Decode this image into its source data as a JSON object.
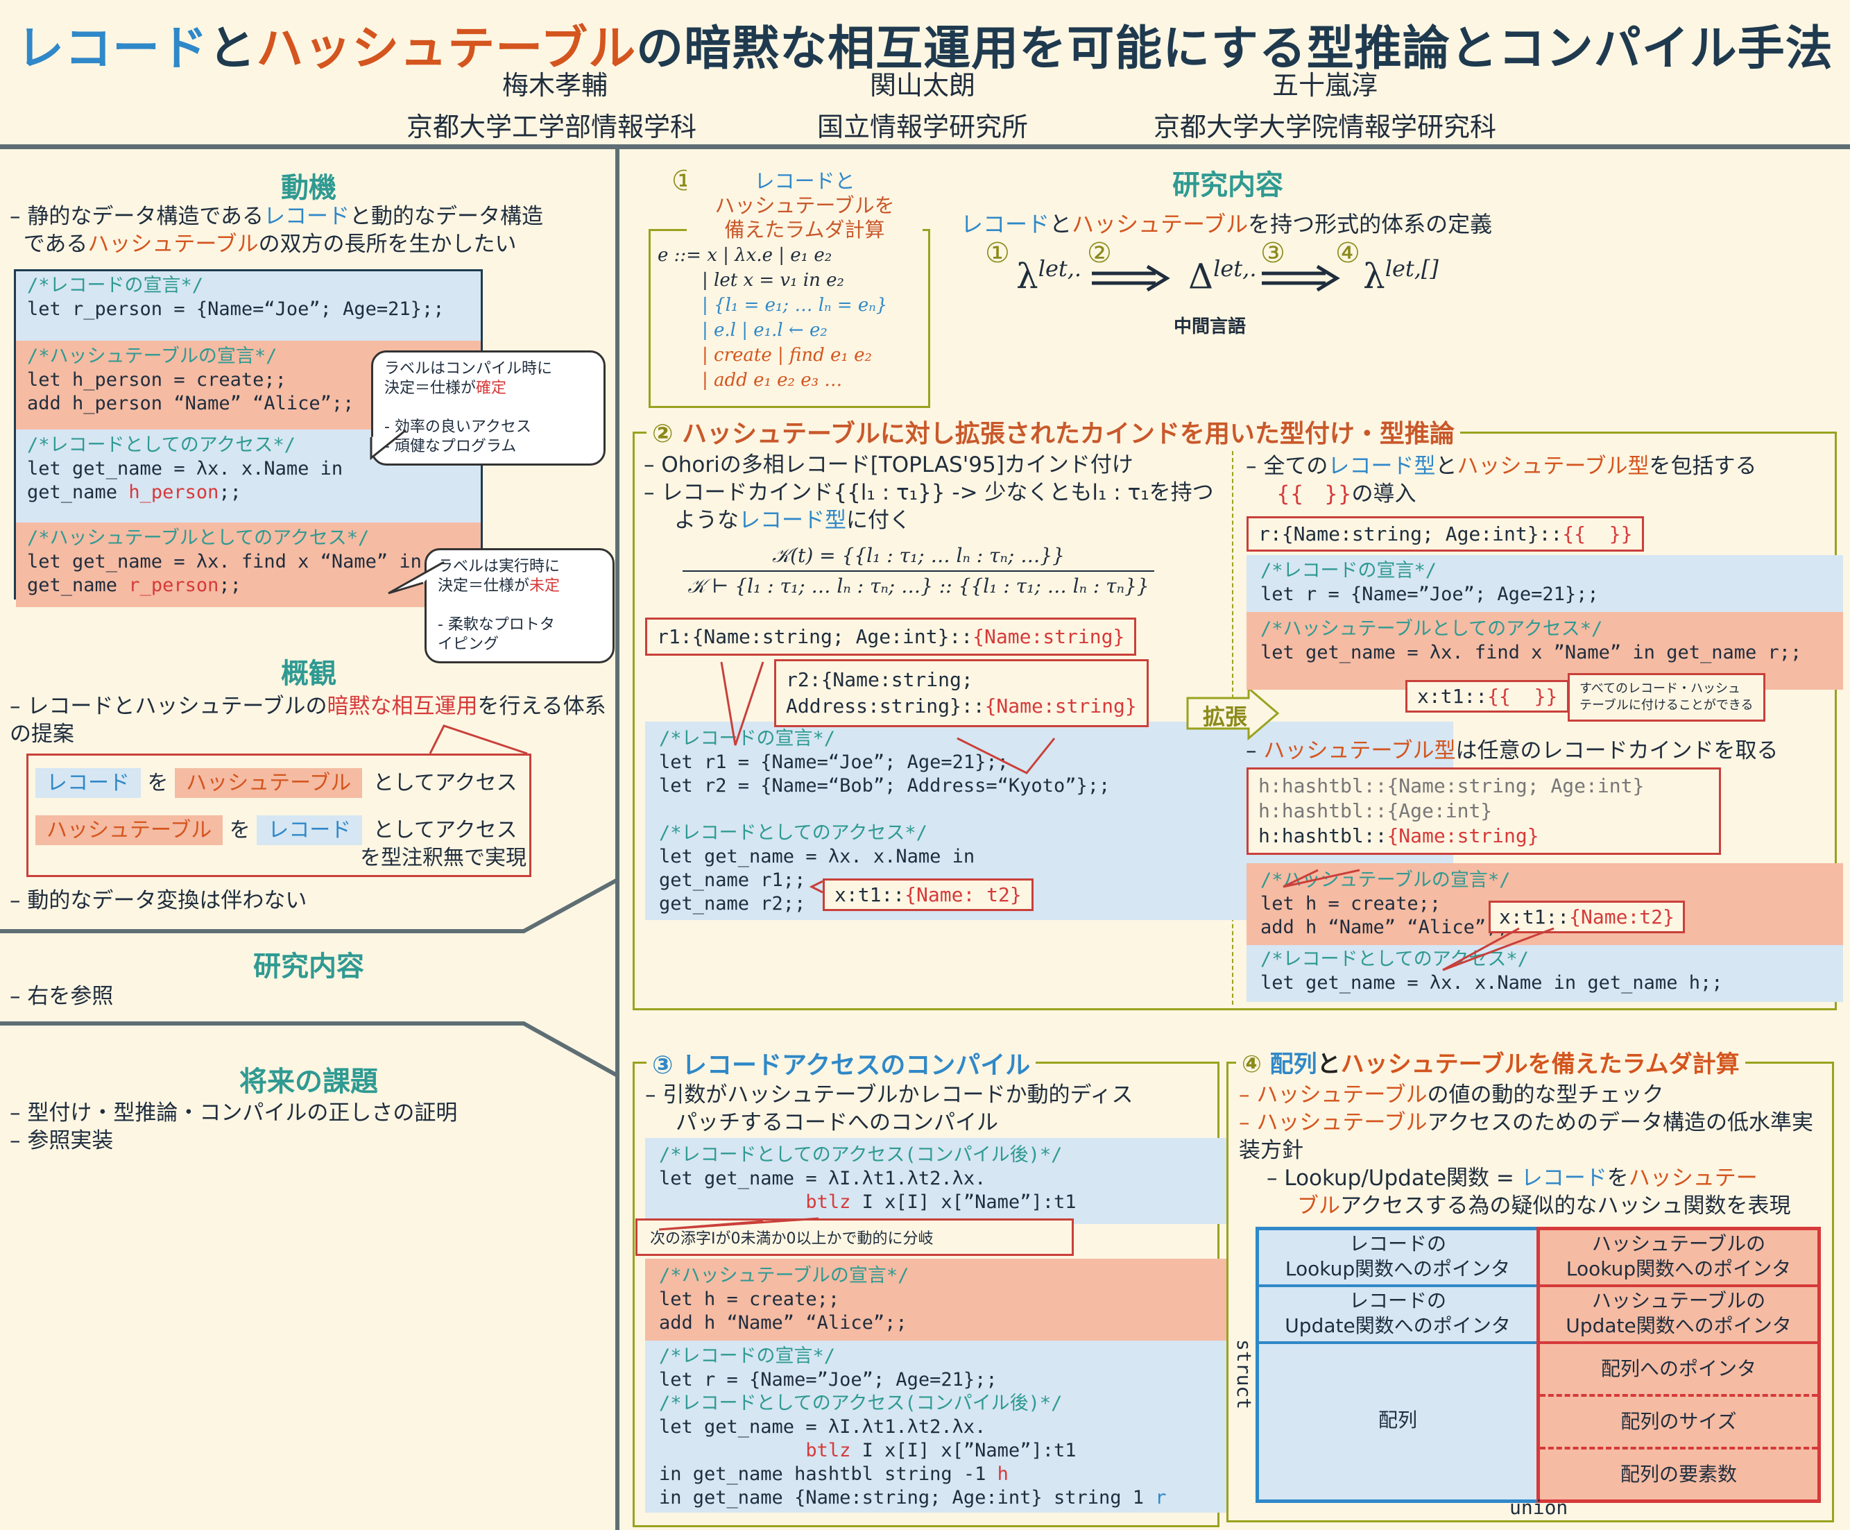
{
  "header": {
    "title_parts": [
      "レコード",
      "と",
      "ハッシュテーブル",
      "の暗黙な相互運用を可能にする型推論とコンパイル手法"
    ],
    "authors": [
      {
        "name": "梅木孝輔",
        "affiliation": "京都大学工学部情報学科"
      },
      {
        "name": "関山太朗",
        "affiliation": "国立情報学研究所"
      },
      {
        "name": "五十嵐淳",
        "affiliation": "京都大学大学院情報学研究科"
      }
    ]
  },
  "motivation": {
    "title": "動機",
    "bullet_parts": [
      "静的なデータ構造である",
      "レコード",
      "と動的なデータ構造であ",
      "ハッシュテーブル",
      "の双方の長所を生かしたい"
    ],
    "bullet_line2_prefix": "である",
    "code1_comment": "/*レコードの宣言*/",
    "code1_line": "let r_person = {Name=“Joe”; Age=21};;",
    "code2_comment": "/*ハッシュテーブルの宣言*/",
    "code2_line1": "let h_person = create;;",
    "code2_line2": "add h_person “Name” “Alice”;;",
    "code3_comment": "/*レコードとしてのアクセス*/",
    "code3_line1": "let get_name = λx. x.Name in",
    "code3_line2_a": "get_name ",
    "code3_line2_b": "h_person",
    ";;": ";;",
    "code4_comment": "/*ハッシュテーブルとしてのアクセス*/",
    "code4_line1": "let get_name = λx. find x “Name” in",
    "code4_line2_a": "get_name ",
    "code4_line2_b": "r_person",
    "callout1": [
      "ラベルはコンパイル時に",
      "決定＝仕様が",
      "確定",
      "",
      "- 効率の良いアクセス",
      "- 頑健なプログラム"
    ],
    "callout2": [
      "ラベルは実行時に",
      "決定＝仕様が",
      "未定",
      "",
      "- 柔軟なプロトタ",
      "イピング"
    ]
  },
  "overview": {
    "title": "概観",
    "bullet_parts": [
      "レコードとハッシュテーブルの",
      "暗黙な相互運用",
      "を行える体系の提案"
    ],
    "row1": [
      "レコード",
      "を",
      "ハッシュテーブル",
      "としてアクセス"
    ],
    "row2": [
      "ハッシュテーブル",
      "を",
      "レコード",
      "としてアクセス"
    ],
    "row2_note": "を型注釈無で実現",
    "bullet2": "動的なデータ変換は伴わない"
  },
  "research_left": {
    "title": "研究内容",
    "bullet": "右を参照"
  },
  "future": {
    "title": "将来の課題",
    "bullets": [
      "型付け・型推論・コンパイルの正しさの証明",
      "参照実装"
    ]
  },
  "research_right": {
    "title": "研究内容",
    "subtitle_parts": [
      "レコード",
      "と",
      "ハッシュテーブル",
      "を持つ形式的体系の定義"
    ],
    "pipeline": {
      "n1": "①",
      "n2": "②",
      "n3": "③",
      "n4": "④",
      "lambda1": "λ",
      "sup1": "let,.",
      "delta": "Δ",
      "sup2": "let,.",
      "lambda2": "λ",
      "sup3": "let,[]",
      "caption": "中間言語"
    }
  },
  "panel1": {
    "num": "①",
    "title_lines": [
      "レコードと",
      "ハッシュテーブルを",
      "備えたラムダ計算"
    ],
    "grammar": [
      "e  ::= x | λx.e | e₁ e₂",
      "| let x = v₁ in e₂",
      "| {l₁ = e₁; … lₙ = eₙ}",
      "| e.l | e₁.l ← e₂",
      "| create | find e₁ e₂",
      "| add e₁ e₂ e₃   …"
    ]
  },
  "panel2": {
    "title_parts": [
      "② ",
      "ハッシュテーブル",
      "に対し拡張されたカインドを用いた型付け・型推論"
    ],
    "left_bullets": [
      "Ohoriの多相レコード[TOPLAS'95]カインド付け",
      "レコードカインド{{l₁ : τ₁}} -> 少なくともl₁ : τ₁を持つ"
    ],
    "left_bullet2_line2_parts": [
      "ような",
      "レコード型",
      "に付く"
    ],
    "rule_num": "𝒦(t) = {{l₁ : τ₁; … lₙ : τₙ; …}}",
    "rule_den": "𝒦 ⊢ {l₁ : τ₁; … lₙ : τₙ; …} :: {{l₁ : τ₁; … lₙ : τₙ}}",
    "type1_a": "r1:{Name:string; Age:int}::",
    "type1_b": "{Name:string}",
    "type2_a1": "r2:{Name:string;",
    "type2_a2": "Address:string}::",
    "type2_b": "{Name:string}",
    "code_comment1": "/*レコードの宣言*/",
    "code_l1": "let r1 = {Name=“Joe”; Age=21};;",
    "code_l2": "let r2 = {Name=“Bob”; Address=“Kyoto”};;",
    "code_comment2": "/*レコードとしてのアクセス*/",
    "code_l3": "let get_name = λx. x.Name in",
    "code_l4": "get_name r1;;",
    "code_l5": "get_name r2;;",
    "type3_a": "x:t1::",
    "type3_b": "{Name: t2}",
    "extend": "拡張",
    "right_bullet1_parts": [
      "全ての",
      "レコード型",
      "と",
      "ハッシュテーブル型",
      "を包括する"
    ],
    "right_bullet1_line2": "の導入",
    "type4_a": "r:{Name:string; Age:int}::",
    "rcode_comment1": "/*レコードの宣言*/",
    "rcode_l1": "let r = {Name=”Joe”; Age=21};;",
    "rcode_comment2": "/*ハッシュテーブルとしてのアクセス*/",
    "rcode_l2": "let get_name = λx. find x ”Name” in get_name r;;",
    "type5_a": "x:t1::",
    "note": [
      "すべてのレコード・ハッシュ",
      "テーブルに付けることができる"
    ],
    "right_bullet2_parts": [
      "ハッシュテーブル型",
      "は任意のレコードカインドを取る"
    ],
    "type6": [
      "h:hashtbl::",
      "{Name:string; Age:int}",
      "h:hashtbl::",
      "{Age:int}",
      "h:hashtbl::",
      "{Name:string}"
    ],
    "hcode_comment1": "/*ハッシュテーブルの宣言*/",
    "hcode_l1": "let h = create;;",
    "hcode_l2": "add h “Name” “Alice”;;",
    "type7_a": "x:t1::",
    "type7_b": "{Name:t2}",
    "hcode_comment2": "/*レコードとしてのアクセス*/",
    "hcode_l3": "let get_name = λx. x.Name in get_name h;;"
  },
  "panel3": {
    "title": "③ レコードアクセスのコンパイル",
    "bullet": [
      "引数がハッシュテーブルかレコードか動的ディス",
      "パッチするコードへのコンパイル"
    ],
    "c1_comment": "/*レコードとしてのアクセス(コンパイル後)*/",
    "c1_l1": "let get_name = λI.λt1.λt2.λx.",
    "c1_l2_a": "btlz",
    "c1_l2_b": " I x[I] x[”Name”]:t1",
    "callout": "次の添字Iが0未満か0以上かで動的に分岐",
    "c2_comment": "/*ハッシュテーブルの宣言*/",
    "c2_l1": "let h = create;;",
    "c2_l2": "add h “Name” “Alice”;;",
    "c3_comment1": "/*レコードの宣言*/",
    "c3_l1": "let r = {Name=”Joe”; Age=21};;",
    "c3_comment2": "/*レコードとしてのアクセス(コンパイル後)*/",
    "c3_l2": "let get_name = λI.λt1.λt2.λx.",
    "c3_l3_a": "btlz",
    "c3_l3_b": " I x[I] x[”Name”]:t1",
    "c3_l4_a": "in get_name hashtbl string -1 ",
    "c3_l4_b": "h",
    "c3_l5_a": "in get_name {Name:string; Age:int} string 1 ",
    "c3_l5_b": "r"
  },
  "panel4": {
    "title_parts": [
      "④ ",
      "配列",
      "と",
      "ハッシュテーブル",
      "を備えたラムダ計算"
    ],
    "bullets": [
      [
        "ハッシュテーブル",
        "の値の動的な型チェック"
      ],
      [
        "ハッシュテーブル",
        "アクセスのためのデータ構造の低水準実装方針"
      ]
    ],
    "sub_bullet_parts": [
      "Lookup/Update関数 = ",
      "レコード",
      "を",
      "ハッシュテー",
      "ブル",
      "アクセスする為の疑似的なハッシュ関数を表現"
    ],
    "left_cells": [
      [
        "レコードの",
        "Lookup関数へのポインタ"
      ],
      [
        "レコードの",
        "Update関数へのポインタ"
      ],
      [
        "配列"
      ]
    ],
    "right_cells": [
      [
        "ハッシュテーブルの",
        "Lookup関数へのポインタ"
      ],
      [
        "ハッシュテーブルの",
        "Update関数へのポインタ"
      ],
      [
        "配列へのポインタ"
      ],
      [
        "配列のサイズ"
      ],
      [
        "配列の要素数"
      ]
    ],
    "label_struct": "struct",
    "label_union": "union",
    "colors": {
      "record": "#2f88c8",
      "hashtable": "#d63a3a",
      "hash_fill": "#f5bba3",
      "rec_fill": "#d6e6f3"
    }
  }
}
